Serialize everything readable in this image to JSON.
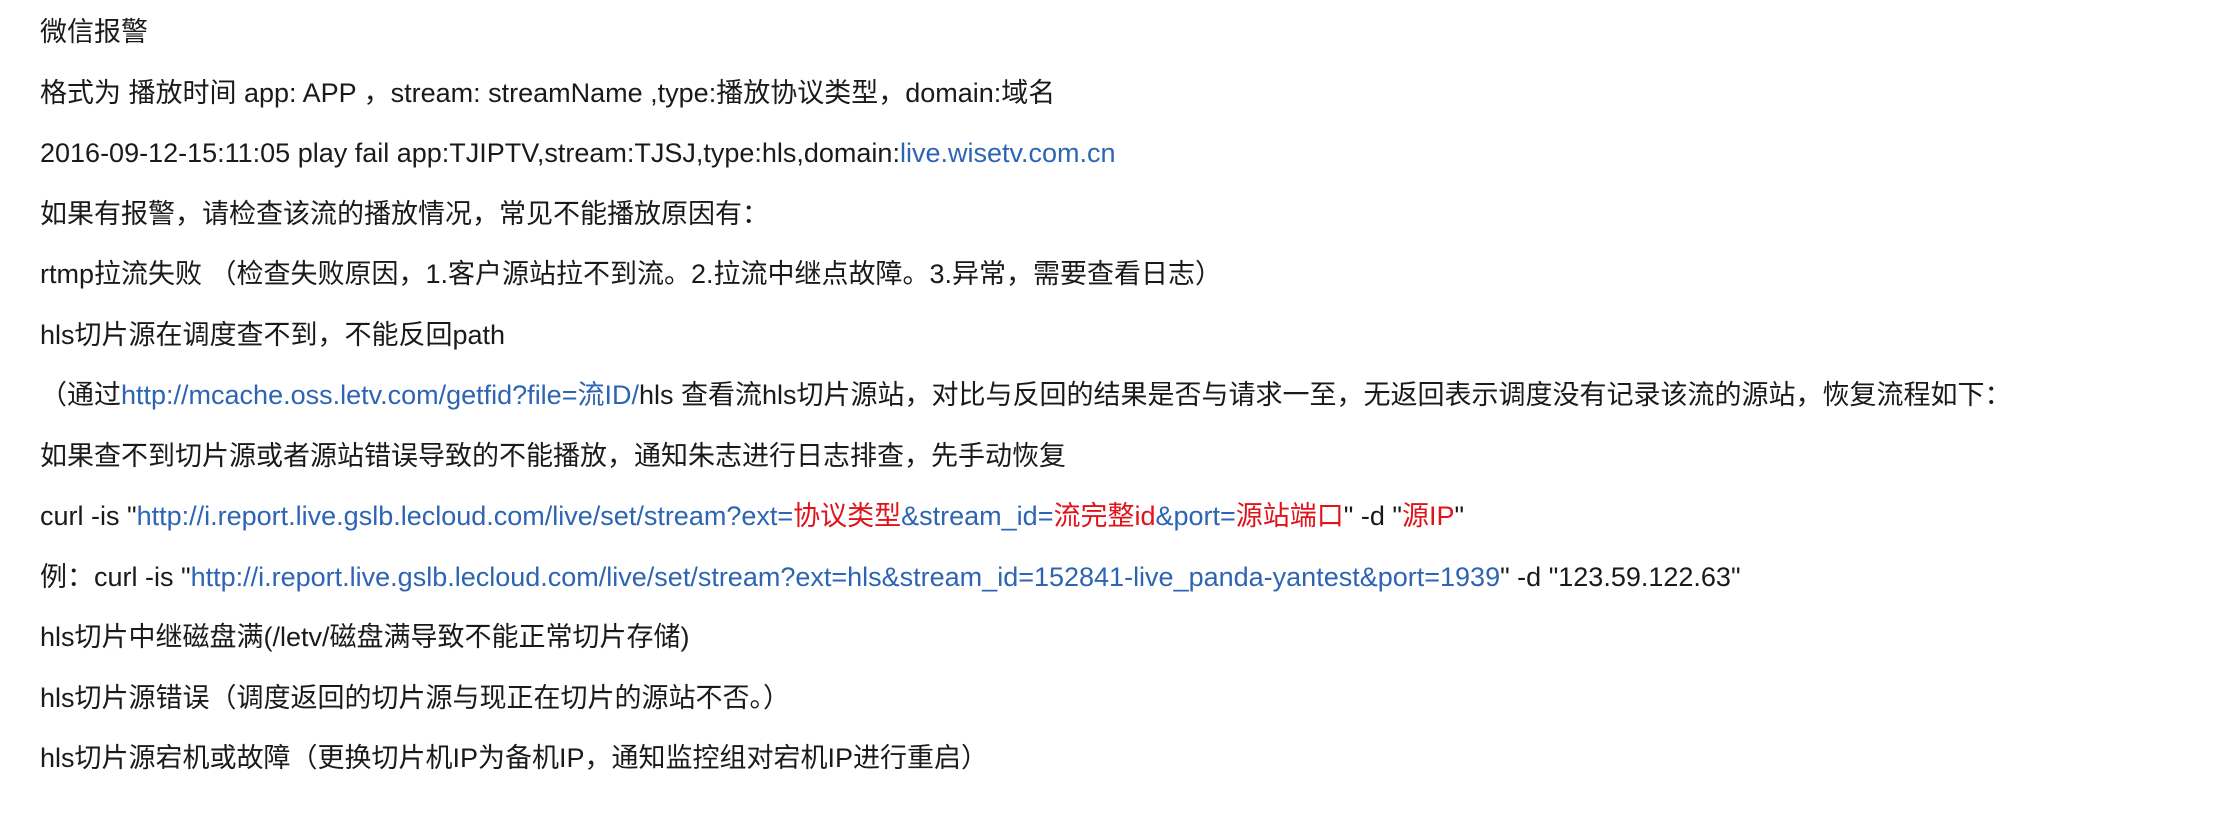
{
  "colors": {
    "text": "#1a1a1a",
    "link": "#2d64b3",
    "highlight": "#e0131a",
    "background": "#ffffff"
  },
  "lines": {
    "l1": {
      "text": "微信报警"
    },
    "l2": {
      "text": "格式为 播放时间  app: APP ，stream: streamName ,type:播放协议类型，domain:域名"
    },
    "l3": {
      "prefix": "2016-09-12-15:11:05 play fail app:TJIPTV,stream:TJSJ,type:hls,domain:",
      "link": "live.wisetv.com.cn"
    },
    "l4": {
      "text": "如果有报警，请检查该流的播放情况，常见不能播放原因有："
    },
    "l5": {
      "text": "rtmp拉流失败 （检查失败原因，1.客户源站拉不到流。2.拉流中继点故障。3.异常，需要查看日志）"
    },
    "l6": {
      "text": "hls切片源在调度查不到，不能反回path"
    },
    "l7": {
      "prefix": " （通过",
      "link": "http://mcache.oss.letv.com/getfid?file=流ID/",
      "suffix": "hls 查看流hls切片源站，对比与反回的结果是否与请求一至，无返回表示调度没有记录该流的源站，恢复流程如下："
    },
    "l8": {
      "text": "如果查不到切片源或者源站错误导致的不能播放，通知朱志进行日志排查，先手动恢复"
    },
    "l9": {
      "prefix": "curl -is \"",
      "link1": "http://i.report.live.gslb.lecloud.com/live/set/stream?ext=",
      "red1": "协议类型",
      "link2": "&stream_id=",
      "red2": "流完整id",
      "link3": "&port=",
      "red3": "源站端口",
      "mid": "\" -d \"",
      "red4": "源IP",
      "end": "\""
    },
    "l10": {
      "prefix": "例：curl -is \"",
      "link": "http://i.report.live.gslb.lecloud.com/live/set/stream?ext=hls&stream_id=152841-live_panda-yantest&port=1939",
      "suffix": "\" -d \"123.59.122.63\""
    },
    "l11": {
      "text": "hls切片中继磁盘满(/letv/磁盘满导致不能正常切片存储)"
    },
    "l12": {
      "text": "hls切片源错误（调度返回的切片源与现正在切片的源站不否。）"
    },
    "l13": {
      "text": "hls切片源宕机或故障（更换切片机IP为备机IP，通知监控组对宕机IP进行重启）"
    }
  }
}
